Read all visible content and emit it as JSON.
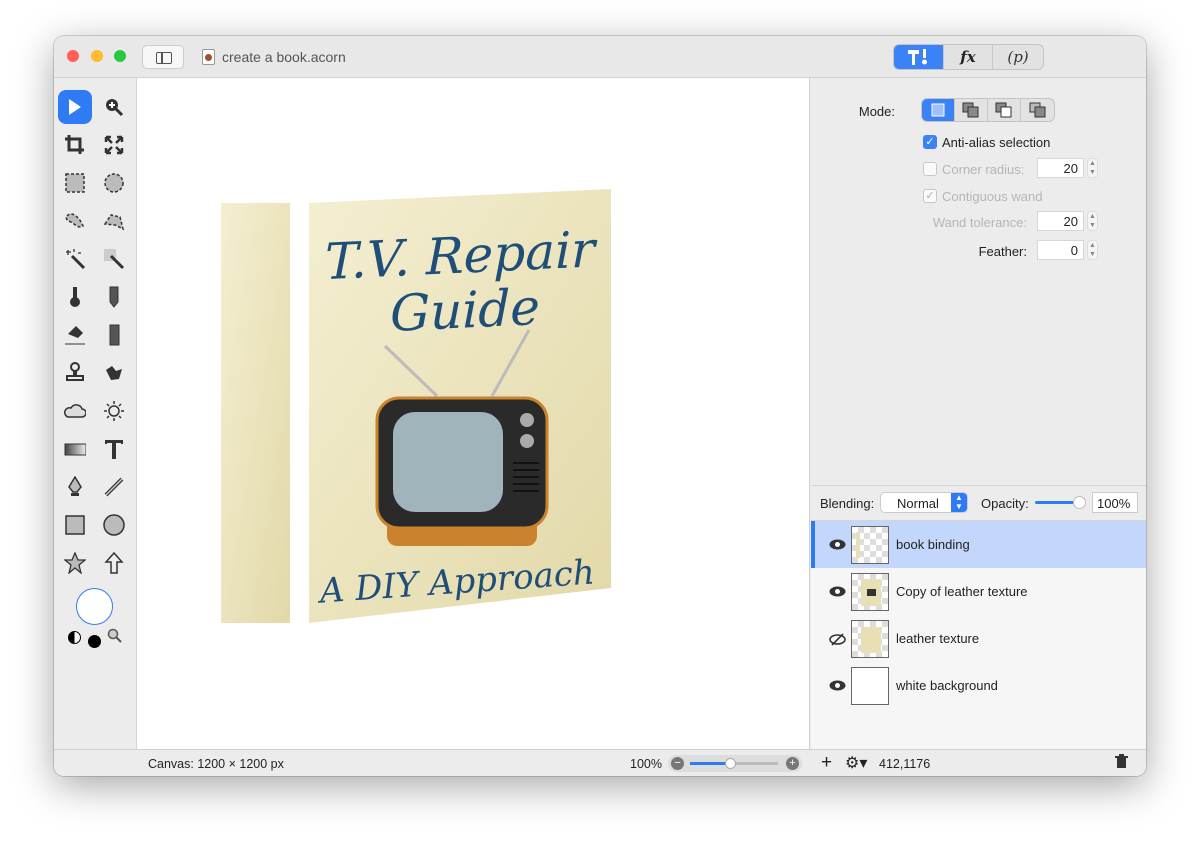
{
  "window": {
    "title": "create a book.acorn",
    "traffic_colors": [
      "#fe5f57",
      "#febc2e",
      "#28c840"
    ]
  },
  "inspector_tabs": [
    {
      "name": "tools",
      "label": "",
      "icon": "hammer-icon",
      "active": true
    },
    {
      "name": "filters",
      "label": "fx",
      "active": false
    },
    {
      "name": "properties",
      "label": "(p)",
      "active": false
    }
  ],
  "tools": [
    {
      "name": "select-arrow",
      "active": true
    },
    {
      "name": "zoom"
    },
    {
      "name": "crop"
    },
    {
      "name": "transform"
    },
    {
      "name": "rect-select"
    },
    {
      "name": "ellipse-select"
    },
    {
      "name": "lasso"
    },
    {
      "name": "polygon-lasso"
    },
    {
      "name": "magic-wand"
    },
    {
      "name": "instant-alpha"
    },
    {
      "name": "brush"
    },
    {
      "name": "pencil"
    },
    {
      "name": "eraser"
    },
    {
      "name": "clone-fill"
    },
    {
      "name": "clone-stamp"
    },
    {
      "name": "smudge"
    },
    {
      "name": "cloud-burn"
    },
    {
      "name": "sun-dodge"
    },
    {
      "name": "gradient"
    },
    {
      "name": "text"
    },
    {
      "name": "pen"
    },
    {
      "name": "line"
    },
    {
      "name": "rectangle-shape"
    },
    {
      "name": "oval-shape"
    },
    {
      "name": "star-shape"
    },
    {
      "name": "arrow-shape"
    }
  ],
  "colors": {
    "accent": "#2f7bf5",
    "foreground": "#ffffff",
    "background": "#000000"
  },
  "canvas": {
    "book_title_line1": "T.V. Repair",
    "book_title_line2": "Guide",
    "book_subtitle": "A DIY Approach",
    "leather_color": "#e8e0b4",
    "text_color": "#1f4e79"
  },
  "tool_options": {
    "mode_label": "Mode:",
    "anti_alias": {
      "label": "Anti-alias selection",
      "checked": true
    },
    "corner_radius": {
      "label": "Corner radius:",
      "value": "20",
      "checked": false
    },
    "contiguous_wand": {
      "label": "Contiguous wand",
      "checked": true
    },
    "wand_tolerance": {
      "label": "Wand tolerance:",
      "value": "20"
    },
    "feather": {
      "label": "Feather:",
      "value": "0"
    }
  },
  "blending": {
    "label": "Blending:",
    "value": "Normal",
    "opacity_label": "Opacity:",
    "opacity_value": "100%",
    "opacity": 1.0
  },
  "layers": [
    {
      "name": "book binding",
      "visible": true,
      "selected": true
    },
    {
      "name": "Copy of leather texture",
      "visible": true,
      "selected": false
    },
    {
      "name": "leather texture",
      "visible": false,
      "selected": false
    },
    {
      "name": "white background",
      "visible": true,
      "selected": false
    }
  ],
  "status": {
    "canvas_size": "Canvas: 1200 × 1200 px",
    "zoom": "100%",
    "zoom_fraction": 0.45,
    "coords": "412,1176"
  }
}
